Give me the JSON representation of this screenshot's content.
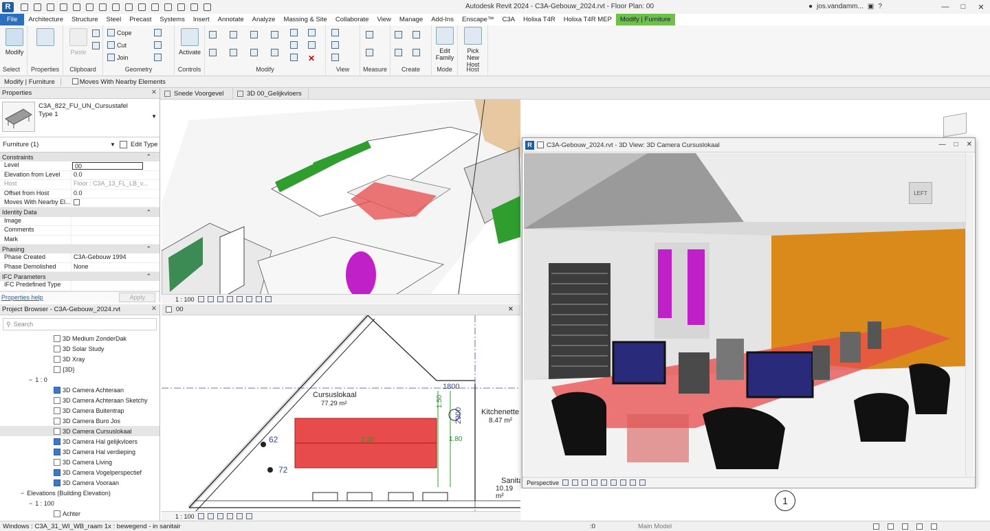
{
  "title_bar": {
    "title": "Autodesk Revit 2024 - C3A-Gebouw_2024.rvt - Floor Plan: 00",
    "user": "jos.vandamm...",
    "logo_letter": "R"
  },
  "ribbon_tabs": [
    "File",
    "Architecture",
    "Structure",
    "Steel",
    "Precast",
    "Systems",
    "Insert",
    "Annotate",
    "Analyze",
    "Massing & Site",
    "Collaborate",
    "View",
    "Manage",
    "Add-Ins",
    "Enscape™",
    "C3A",
    "Holixa T4R",
    "Holixa T4R MEP",
    "Modify | Furniture"
  ],
  "ribbon": {
    "modify": "Modify",
    "select": "Select",
    "properties": "Properties",
    "paste": "Paste",
    "clipboard": "Clipboard",
    "cope": "Cope",
    "cut": "Cut",
    "join": "Join",
    "geometry": "Geometry",
    "activate": "Activate",
    "controls": "Controls",
    "modify_panel": "Modify",
    "view": "View",
    "measure": "Measure",
    "create": "Create",
    "edit_family": "Edit Family",
    "mode": "Mode",
    "pick_new_host": "Pick New Host",
    "host": "Host"
  },
  "options_bar": {
    "context": "Modify | Furniture",
    "moves_with_nearby": "Moves With Nearby Elements"
  },
  "properties": {
    "header": "Properties",
    "type_name": "C3A_822_FU_UN_Cursustafel",
    "type_sub": "Type 1",
    "category": "Furniture (1)",
    "edit_type": "Edit Type",
    "sections": [
      {
        "name": "Constraints",
        "rows": [
          {
            "k": "Level",
            "v": "00"
          },
          {
            "k": "Elevation from Level",
            "v": "0.0"
          },
          {
            "k": "Host",
            "v": "Floor : C3A_13_FL_LB_v..."
          },
          {
            "k": "Offset from Host",
            "v": "0.0"
          },
          {
            "k": "Moves With Nearby El...",
            "v": ""
          }
        ]
      },
      {
        "name": "Identity Data",
        "rows": [
          {
            "k": "Image",
            "v": ""
          },
          {
            "k": "Comments",
            "v": ""
          },
          {
            "k": "Mark",
            "v": ""
          }
        ]
      },
      {
        "name": "Phasing",
        "rows": [
          {
            "k": "Phase Created",
            "v": "C3A-Gebouw 1994"
          },
          {
            "k": "Phase Demolished",
            "v": "None"
          }
        ]
      },
      {
        "name": "IFC Parameters",
        "rows": [
          {
            "k": "IFC Predefined Type",
            "v": ""
          }
        ]
      }
    ],
    "help": "Properties help",
    "apply": "Apply"
  },
  "project_browser": {
    "header": "Project Browser - C3A-Gebouw_2024.rvt",
    "search": "Search",
    "items": [
      {
        "label": "3D Medium ZonderDak",
        "indent": 78,
        "type": "view"
      },
      {
        "label": "3D Solar Study",
        "indent": 78,
        "type": "view"
      },
      {
        "label": "3D Xray",
        "indent": 78,
        "type": "view"
      },
      {
        "label": "{3D}",
        "indent": 78,
        "type": "view"
      },
      {
        "label": "1 : 0",
        "indent": 54,
        "type": "group"
      },
      {
        "label": "3D Camera Achteraan",
        "indent": 78,
        "type": "cam"
      },
      {
        "label": "3D Camera Achteraan Sketchy",
        "indent": 78,
        "type": "view"
      },
      {
        "label": "3D Camera Buitentrap",
        "indent": 78,
        "type": "view"
      },
      {
        "label": "3D Camera Buro Jos",
        "indent": 78,
        "type": "view"
      },
      {
        "label": "3D Camera Cursuslokaal",
        "indent": 78,
        "type": "view"
      },
      {
        "label": "3D Camera Hal gelijkvloers",
        "indent": 78,
        "type": "cam"
      },
      {
        "label": "3D Camera Hal verdieping",
        "indent": 78,
        "type": "cam"
      },
      {
        "label": "3D Camera Living",
        "indent": 78,
        "type": "view"
      },
      {
        "label": "3D Camera Vogelperspectief",
        "indent": 78,
        "type": "cam"
      },
      {
        "label": "3D Camera Vooraan",
        "indent": 78,
        "type": "cam"
      },
      {
        "label": "Elevations (Building Elevation)",
        "indent": 42,
        "type": "group"
      },
      {
        "label": "1 : 100",
        "indent": 54,
        "type": "group"
      },
      {
        "label": "Achter",
        "indent": 78,
        "type": "view"
      }
    ]
  },
  "view_tabs": [
    "Snede Voorgevel",
    "3D 00_Gelijkvloers"
  ],
  "plan_tab": "00",
  "scale_top": "1 : 100",
  "scale_bottom": "1 : 100",
  "floating_view": {
    "title": "C3A-Gebouw_2024.rvt - 3D View: 3D Camera Cursuslokaal",
    "mode": "Perspective",
    "cube_label": "LEFT"
  },
  "plan": {
    "room1_name": "Cursuslokaal",
    "room1_area": "77.29 m²",
    "room2_name": "Kitchenette",
    "room2_area": "8.47 m²",
    "room3_name": "Sanitair",
    "room3_area": "10.19 m²",
    "dim1": "1800",
    "dim2": "2900",
    "dim3": "1.50",
    "dim4": "1.80",
    "dim5": "2.30",
    "tag1": "62",
    "tag2": "72",
    "grid": "1"
  },
  "status_bar": {
    "text": "Windows : C3A_31_WI_WB_raam 1x : bewegend - in sanitair",
    "model": "Main Model",
    "count": ":0"
  },
  "colors": {
    "file_tab": "#2c6fc0",
    "context_tab": "#6fbf4a",
    "furniture_red": "#e84b4b",
    "wall_orange": "#d98a1b",
    "magenta": "#c020c8",
    "green_roof": "#2f9e2f"
  }
}
